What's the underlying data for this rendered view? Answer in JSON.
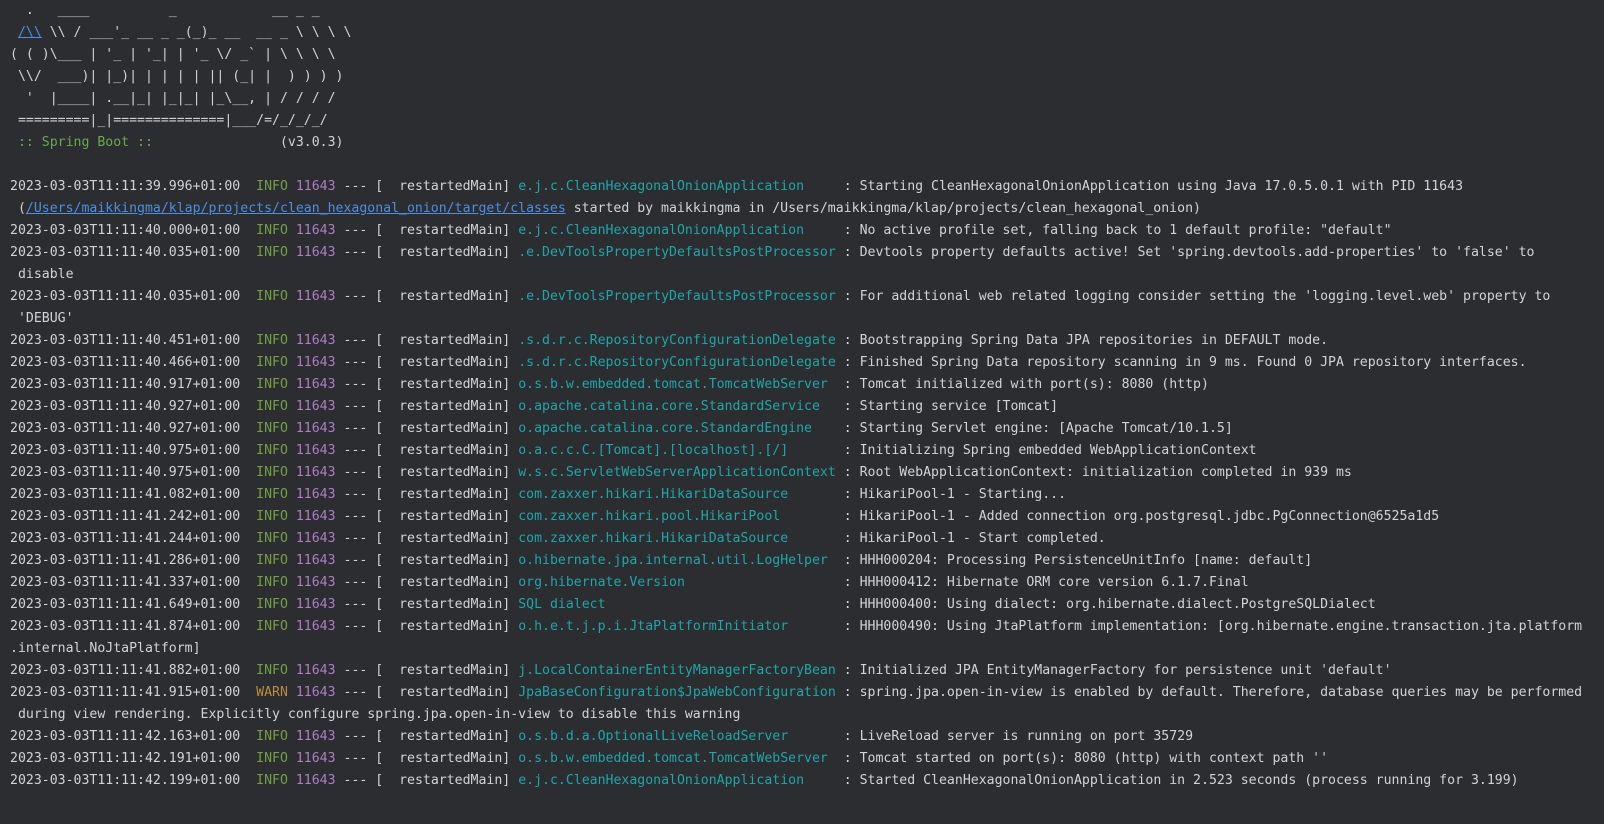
{
  "banner": {
    "lines": [
      "  .   ____          _            __ _ _",
      " \\\\ / ___'_ __ _ _(_)_ __  __ _ \\ \\ \\ \\",
      "( ( )\\___ | '_ | '_| | '_ \\/ _` | \\ \\ \\ \\",
      " \\\\/  ___)| |_)| | | | | || (_| |  ) ) ) )",
      "  '  |____| .__|_| |_|_| |_\\__, | / / / /",
      " =========|_|==============|___/=/_/_/_/"
    ],
    "link_glyph": "/\\\\",
    "spring_label": " :: Spring Boot :: ",
    "version": "               (v3.0.3)"
  },
  "log_entries": [
    {
      "timestamp": "2023-03-03T11:11:39.996+01:00",
      "level": "INFO",
      "pid": "11643",
      "sep": " --- [  restartedMain] ",
      "logger": "e.j.c.CleanHexagonalOnionApplication    ",
      "message": " : Starting CleanHexagonalOnionApplication using Java 17.0.5.0.1 with PID 11643",
      "continuation_prefix": " (",
      "continuation_link": "/Users/maikkingma/klap/projects/clean_hexagonal_onion/target/classes",
      "continuation_text": " started by maikkingma in /Users/maikkingma/klap/projects/clean_hexagonal_onion)"
    },
    {
      "timestamp": "2023-03-03T11:11:40.000+01:00",
      "level": "INFO",
      "pid": "11643",
      "sep": " --- [  restartedMain] ",
      "logger": "e.j.c.CleanHexagonalOnionApplication    ",
      "message": " : No active profile set, falling back to 1 default profile: \"default\""
    },
    {
      "timestamp": "2023-03-03T11:11:40.035+01:00",
      "level": "INFO",
      "pid": "11643",
      "sep": " --- [  restartedMain] ",
      "logger": ".e.DevToolsPropertyDefaultsPostProcessor",
      "message": " : Devtools property defaults active! Set 'spring.devtools.add-properties' to 'false' to",
      "continuation_text": " disable"
    },
    {
      "timestamp": "2023-03-03T11:11:40.035+01:00",
      "level": "INFO",
      "pid": "11643",
      "sep": " --- [  restartedMain] ",
      "logger": ".e.DevToolsPropertyDefaultsPostProcessor",
      "message": " : For additional web related logging consider setting the 'logging.level.web' property to",
      "continuation_text": " 'DEBUG'"
    },
    {
      "timestamp": "2023-03-03T11:11:40.451+01:00",
      "level": "INFO",
      "pid": "11643",
      "sep": " --- [  restartedMain] ",
      "logger": ".s.d.r.c.RepositoryConfigurationDelegate",
      "message": " : Bootstrapping Spring Data JPA repositories in DEFAULT mode."
    },
    {
      "timestamp": "2023-03-03T11:11:40.466+01:00",
      "level": "INFO",
      "pid": "11643",
      "sep": " --- [  restartedMain] ",
      "logger": ".s.d.r.c.RepositoryConfigurationDelegate",
      "message": " : Finished Spring Data repository scanning in 9 ms. Found 0 JPA repository interfaces."
    },
    {
      "timestamp": "2023-03-03T11:11:40.917+01:00",
      "level": "INFO",
      "pid": "11643",
      "sep": " --- [  restartedMain] ",
      "logger": "o.s.b.w.embedded.tomcat.TomcatWebServer ",
      "message": " : Tomcat initialized with port(s): 8080 (http)"
    },
    {
      "timestamp": "2023-03-03T11:11:40.927+01:00",
      "level": "INFO",
      "pid": "11643",
      "sep": " --- [  restartedMain] ",
      "logger": "o.apache.catalina.core.StandardService  ",
      "message": " : Starting service [Tomcat]"
    },
    {
      "timestamp": "2023-03-03T11:11:40.927+01:00",
      "level": "INFO",
      "pid": "11643",
      "sep": " --- [  restartedMain] ",
      "logger": "o.apache.catalina.core.StandardEngine   ",
      "message": " : Starting Servlet engine: [Apache Tomcat/10.1.5]"
    },
    {
      "timestamp": "2023-03-03T11:11:40.975+01:00",
      "level": "INFO",
      "pid": "11643",
      "sep": " --- [  restartedMain] ",
      "logger": "o.a.c.c.C.[Tomcat].[localhost].[/]      ",
      "message": " : Initializing Spring embedded WebApplicationContext"
    },
    {
      "timestamp": "2023-03-03T11:11:40.975+01:00",
      "level": "INFO",
      "pid": "11643",
      "sep": " --- [  restartedMain] ",
      "logger": "w.s.c.ServletWebServerApplicationContext",
      "message": " : Root WebApplicationContext: initialization completed in 939 ms"
    },
    {
      "timestamp": "2023-03-03T11:11:41.082+01:00",
      "level": "INFO",
      "pid": "11643",
      "sep": " --- [  restartedMain] ",
      "logger": "com.zaxxer.hikari.HikariDataSource      ",
      "message": " : HikariPool-1 - Starting..."
    },
    {
      "timestamp": "2023-03-03T11:11:41.242+01:00",
      "level": "INFO",
      "pid": "11643",
      "sep": " --- [  restartedMain] ",
      "logger": "com.zaxxer.hikari.pool.HikariPool       ",
      "message": " : HikariPool-1 - Added connection org.postgresql.jdbc.PgConnection@6525a1d5"
    },
    {
      "timestamp": "2023-03-03T11:11:41.244+01:00",
      "level": "INFO",
      "pid": "11643",
      "sep": " --- [  restartedMain] ",
      "logger": "com.zaxxer.hikari.HikariDataSource      ",
      "message": " : HikariPool-1 - Start completed."
    },
    {
      "timestamp": "2023-03-03T11:11:41.286+01:00",
      "level": "INFO",
      "pid": "11643",
      "sep": " --- [  restartedMain] ",
      "logger": "o.hibernate.jpa.internal.util.LogHelper ",
      "message": " : HHH000204: Processing PersistenceUnitInfo [name: default]"
    },
    {
      "timestamp": "2023-03-03T11:11:41.337+01:00",
      "level": "INFO",
      "pid": "11643",
      "sep": " --- [  restartedMain] ",
      "logger": "org.hibernate.Version                   ",
      "message": " : HHH000412: Hibernate ORM core version 6.1.7.Final"
    },
    {
      "timestamp": "2023-03-03T11:11:41.649+01:00",
      "level": "INFO",
      "pid": "11643",
      "sep": " --- [  restartedMain] ",
      "logger": "SQL dialect                             ",
      "message": " : HHH000400: Using dialect: org.hibernate.dialect.PostgreSQLDialect"
    },
    {
      "timestamp": "2023-03-03T11:11:41.874+01:00",
      "level": "INFO",
      "pid": "11643",
      "sep": " --- [  restartedMain] ",
      "logger": "o.h.e.t.j.p.i.JtaPlatformInitiator      ",
      "message": " : HHH000490: Using JtaPlatform implementation: [org.hibernate.engine.transaction.jta.platform",
      "continuation_text": ".internal.NoJtaPlatform]"
    },
    {
      "timestamp": "2023-03-03T11:11:41.882+01:00",
      "level": "INFO",
      "pid": "11643",
      "sep": " --- [  restartedMain] ",
      "logger": "j.LocalContainerEntityManagerFactoryBean",
      "message": " : Initialized JPA EntityManagerFactory for persistence unit 'default'"
    },
    {
      "timestamp": "2023-03-03T11:11:41.915+01:00",
      "level": "WARN",
      "pid": "11643",
      "sep": " --- [  restartedMain] ",
      "logger": "JpaBaseConfiguration$JpaWebConfiguration",
      "message": " : spring.jpa.open-in-view is enabled by default. Therefore, database queries may be performed",
      "continuation_text": " during view rendering. Explicitly configure spring.jpa.open-in-view to disable this warning"
    },
    {
      "timestamp": "2023-03-03T11:11:42.163+01:00",
      "level": "INFO",
      "pid": "11643",
      "sep": " --- [  restartedMain] ",
      "logger": "o.s.b.d.a.OptionalLiveReloadServer      ",
      "message": " : LiveReload server is running on port 35729"
    },
    {
      "timestamp": "2023-03-03T11:11:42.191+01:00",
      "level": "INFO",
      "pid": "11643",
      "sep": " --- [  restartedMain] ",
      "logger": "o.s.b.w.embedded.tomcat.TomcatWebServer ",
      "message": " : Tomcat started on port(s): 8080 (http) with context path ''"
    },
    {
      "timestamp": "2023-03-03T11:11:42.199+01:00",
      "level": "INFO",
      "pid": "11643",
      "sep": " --- [  restartedMain] ",
      "logger": "e.j.c.CleanHexagonalOnionApplication    ",
      "message": " : Started CleanHexagonalOnionApplication in 2.523 seconds (process running for 3.199)"
    }
  ],
  "colors": {
    "background": "#2b2d30",
    "text": "#d1d3d8",
    "info": "#73a043",
    "warn": "#c08a3e",
    "pid": "#b07cc6",
    "logger": "#1fa6a8",
    "link": "#4d8fe0",
    "spring_label": "#6aa84f"
  }
}
